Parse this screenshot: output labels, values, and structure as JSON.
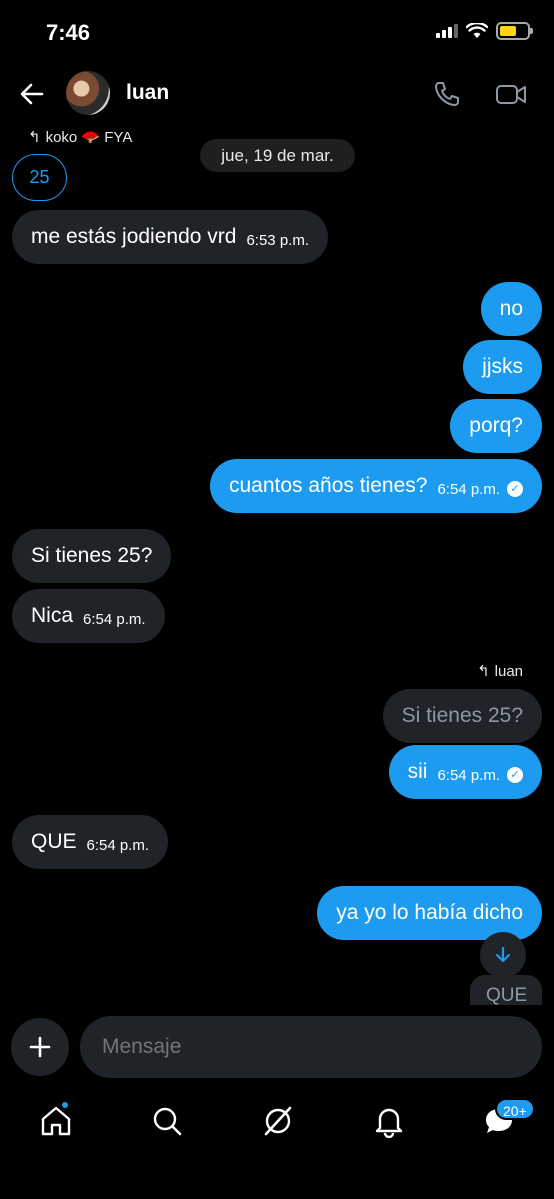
{
  "status": {
    "time": "7:46"
  },
  "header": {
    "contact_name": "luan"
  },
  "top_reply": {
    "label": "koko 🪭 FYA"
  },
  "date_separator": "jue, 19 de mar.",
  "count_badge": "25",
  "messages": [
    {
      "text": "me estás jodiendo vrd",
      "time": "6:53 p.m."
    },
    {
      "text": "no"
    },
    {
      "text": "jjsks"
    },
    {
      "text": "porq?"
    },
    {
      "text": "cuantos años tienes?",
      "time": "6:54 p.m."
    },
    {
      "text": "Si tienes 25?"
    },
    {
      "text": "Nica",
      "time": "6:54 p.m."
    },
    {
      "text": "Si tienes 25?"
    },
    {
      "text": "sii",
      "time": "6:54 p.m."
    },
    {
      "text": "QUE",
      "time": "6:54 p.m."
    },
    {
      "text": "ya yo lo había dicho"
    },
    {
      "text": "QUE"
    }
  ],
  "reply_to_luan": "luan",
  "composer": {
    "placeholder": "Mensaje"
  },
  "tabs": {
    "messages_badge": "20+"
  },
  "colors": {
    "accent": "#1d9bf0",
    "incoming_bubble": "#202327",
    "background": "#000000"
  }
}
